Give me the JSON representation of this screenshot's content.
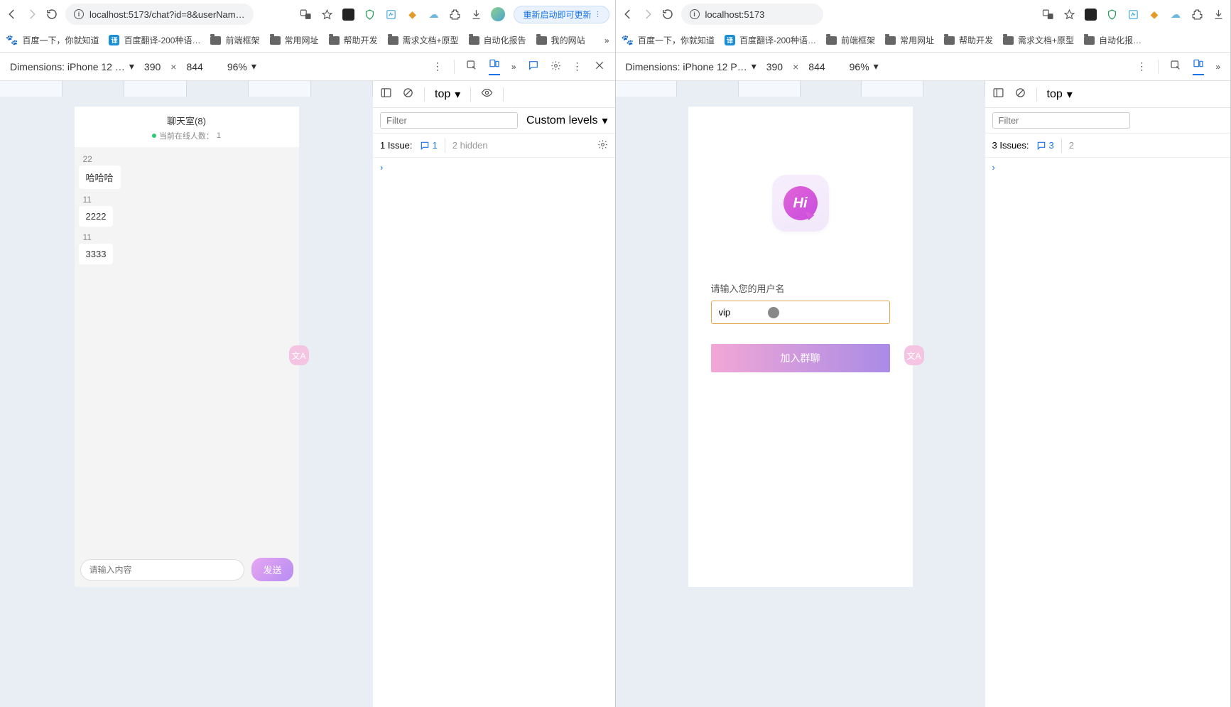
{
  "left": {
    "url": "localhost:5173/chat?id=8&userNam…",
    "restart_btn": "重新启动即可更新",
    "bookmarks": [
      "百度一下，你就知道",
      "百度翻译-200种语…",
      "前端框架",
      "常用网址",
      "帮助开发",
      "需求文档+原型",
      "自动化报告",
      "我的网站"
    ],
    "device": {
      "name": "Dimensions: iPhone 12 …",
      "w": "390",
      "h": "844",
      "zoom": "96%"
    },
    "console": {
      "context": "top",
      "filter_ph": "Filter",
      "levels": "Custom levels",
      "issues_label": "1 Issue:",
      "issues_n": "1",
      "hidden": "2 hidden"
    },
    "app": {
      "title": "聊天室(8)",
      "online_label": "当前在线人数：",
      "online_n": "1",
      "msgs": [
        {
          "u": "22",
          "t": "哈哈哈"
        },
        {
          "u": "11",
          "t": "2222"
        },
        {
          "u": "11",
          "t": "3333"
        }
      ],
      "input_ph": "请输入内容",
      "send": "发送"
    }
  },
  "right": {
    "url": "localhost:5173",
    "bookmarks": [
      "百度一下，你就知道",
      "百度翻译-200种语…",
      "前端框架",
      "常用网址",
      "帮助开发",
      "需求文档+原型",
      "自动化报…"
    ],
    "device": {
      "name": "Dimensions: iPhone 12 P…",
      "w": "390",
      "h": "844",
      "zoom": "96%"
    },
    "console": {
      "context": "top",
      "filter_ph": "Filter",
      "issues_label": "3 Issues:",
      "issues_n": "3",
      "hidden": "2"
    },
    "app": {
      "logo": "Hi",
      "label": "请输入您的用户名",
      "value": "vip",
      "join": "加入群聊"
    }
  }
}
